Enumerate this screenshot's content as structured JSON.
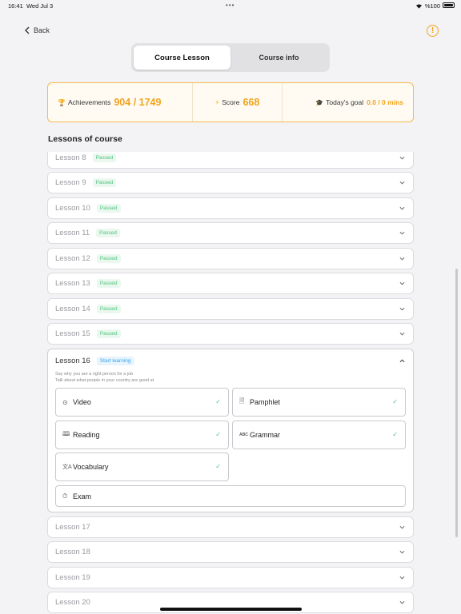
{
  "status_bar": {
    "time": "16:41",
    "date": "Wed Jul 3",
    "battery": "%100"
  },
  "nav": {
    "back_label": "Back",
    "info_label": "!"
  },
  "tabs": [
    {
      "label": "Course Lesson",
      "active": true
    },
    {
      "label": "Course info",
      "active": false
    }
  ],
  "stats": {
    "achievements_label": "Achievements",
    "achievements_value": "904 / 1749",
    "score_label": "Score",
    "score_value": "668",
    "goal_label": "Today's goal",
    "goal_value": "0.0 / 0 mins"
  },
  "lessons_title": "Lessons of course",
  "lessons_before": [
    {
      "name": "Lesson 8",
      "badge": "Passed"
    },
    {
      "name": "Lesson 9",
      "badge": "Passed"
    },
    {
      "name": "Lesson 10",
      "badge": "Passed"
    },
    {
      "name": "Lesson 11",
      "badge": "Passed"
    },
    {
      "name": "Lesson 12",
      "badge": "Passed"
    },
    {
      "name": "Lesson 13",
      "badge": "Passed"
    },
    {
      "name": "Lesson 14",
      "badge": "Passed"
    },
    {
      "name": "Lesson 15",
      "badge": "Passed"
    }
  ],
  "current_lesson": {
    "name": "Lesson 16",
    "badge": "Start learning",
    "description": [
      "Say why you are a right person for a job",
      "Talk about what people in your country are good at"
    ],
    "items": [
      {
        "label": "Video",
        "icon": "play-circle-icon",
        "done": true
      },
      {
        "label": "Pamphlet",
        "icon": "document-icon",
        "done": true
      },
      {
        "label": "Reading",
        "icon": "book-icon",
        "done": true
      },
      {
        "label": "Grammar",
        "icon": "abc-icon",
        "done": true
      },
      {
        "label": "Vocabulary",
        "icon": "translate-icon",
        "done": true
      },
      {
        "label": "Exam",
        "icon": "stopwatch-icon",
        "done": false
      }
    ]
  },
  "lessons_after": [
    {
      "name": "Lesson 17"
    },
    {
      "name": "Lesson 18"
    },
    {
      "name": "Lesson 19"
    },
    {
      "name": "Lesson 20"
    }
  ],
  "colors": {
    "accent": "#f2a31b",
    "passed": "#4cc47a",
    "start": "#3aa5e8"
  }
}
